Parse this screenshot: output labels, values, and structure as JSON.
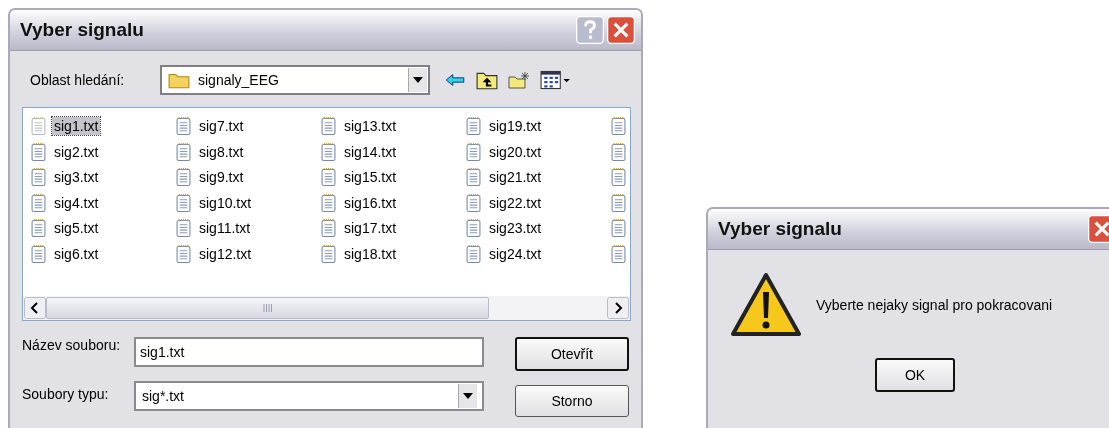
{
  "open_dialog": {
    "title": "Vyber signalu",
    "look_in": {
      "label": "Oblast hledání:",
      "value": "signaly_EEG"
    },
    "files": [
      {
        "kind": "file",
        "name": "sig1.txt",
        "selected": true
      },
      {
        "kind": "file",
        "name": "sig7.txt",
        "selected": false
      },
      {
        "kind": "file",
        "name": "sig13.txt",
        "selected": false
      },
      {
        "kind": "file",
        "name": "sig19.txt",
        "selected": false
      },
      {
        "kind": "cut"
      },
      {
        "kind": "file",
        "name": "sig2.txt",
        "selected": false
      },
      {
        "kind": "file",
        "name": "sig8.txt",
        "selected": false
      },
      {
        "kind": "file",
        "name": "sig14.txt",
        "selected": false
      },
      {
        "kind": "file",
        "name": "sig20.txt",
        "selected": false
      },
      {
        "kind": "cut"
      },
      {
        "kind": "file",
        "name": "sig3.txt",
        "selected": false
      },
      {
        "kind": "file",
        "name": "sig9.txt",
        "selected": false
      },
      {
        "kind": "file",
        "name": "sig15.txt",
        "selected": false
      },
      {
        "kind": "file",
        "name": "sig21.txt",
        "selected": false
      },
      {
        "kind": "cut"
      },
      {
        "kind": "file",
        "name": "sig4.txt",
        "selected": false
      },
      {
        "kind": "file",
        "name": "sig10.txt",
        "selected": false
      },
      {
        "kind": "file",
        "name": "sig16.txt",
        "selected": false
      },
      {
        "kind": "file",
        "name": "sig22.txt",
        "selected": false
      },
      {
        "kind": "cut"
      },
      {
        "kind": "file",
        "name": "sig5.txt",
        "selected": false
      },
      {
        "kind": "file",
        "name": "sig11.txt",
        "selected": false
      },
      {
        "kind": "file",
        "name": "sig17.txt",
        "selected": false
      },
      {
        "kind": "file",
        "name": "sig23.txt",
        "selected": false
      },
      {
        "kind": "cut"
      },
      {
        "kind": "file",
        "name": "sig6.txt",
        "selected": false
      },
      {
        "kind": "file",
        "name": "sig12.txt",
        "selected": false
      },
      {
        "kind": "file",
        "name": "sig18.txt",
        "selected": false
      },
      {
        "kind": "file",
        "name": "sig24.txt",
        "selected": false
      },
      {
        "kind": "cut"
      }
    ],
    "file_name": {
      "label": "Název souboru:",
      "value": "sig1.txt"
    },
    "file_type": {
      "label": "Soubory typu:",
      "value": "sig*.txt"
    },
    "buttons": [
      "Otevřít",
      "Storno"
    ]
  },
  "message_box": {
    "title": "Vyber signalu",
    "message": "Vyberte nejaky signal pro pokracovani",
    "button": "OK"
  }
}
